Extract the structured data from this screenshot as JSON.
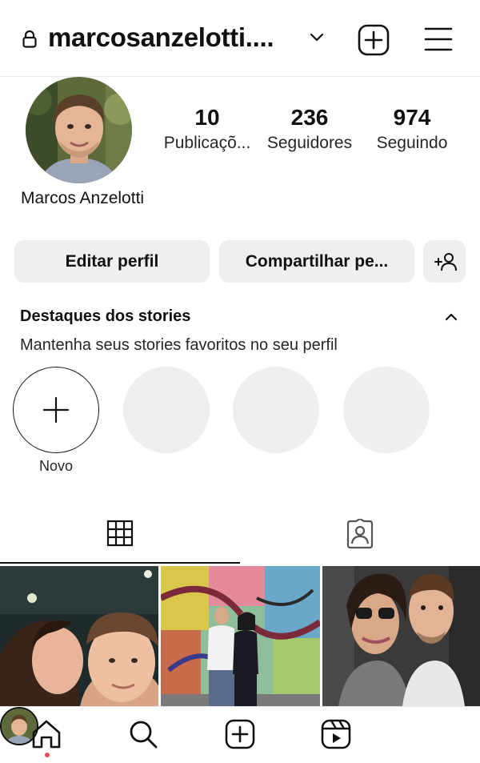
{
  "header": {
    "username": "marcosanzelotti....",
    "icons": [
      "lock-icon",
      "chevron-down-icon",
      "new-post-icon",
      "menu-icon"
    ]
  },
  "profile": {
    "full_name": "Marcos Anzelotti",
    "stats": {
      "posts": {
        "count": "10",
        "label": "Publicaçõ..."
      },
      "followers": {
        "count": "236",
        "label": "Seguidores"
      },
      "following": {
        "count": "974",
        "label": "Seguindo"
      }
    }
  },
  "actions": {
    "edit_label": "Editar perfil",
    "share_label": "Compartilhar pe...",
    "discover_icon": "add-person-icon"
  },
  "highlights": {
    "title": "Destaques dos stories",
    "subtitle": "Mantenha seus stories favoritos no seu perfil",
    "new_label": "Novo"
  },
  "tabs": [
    "grid-icon",
    "tagged-icon"
  ],
  "bottom_nav": [
    "home-icon",
    "search-icon",
    "create-icon",
    "reels-icon",
    "profile-avatar"
  ],
  "colors": {
    "button_bg": "#efefef",
    "notification_dot": "#ed4956",
    "text": "#111111"
  }
}
